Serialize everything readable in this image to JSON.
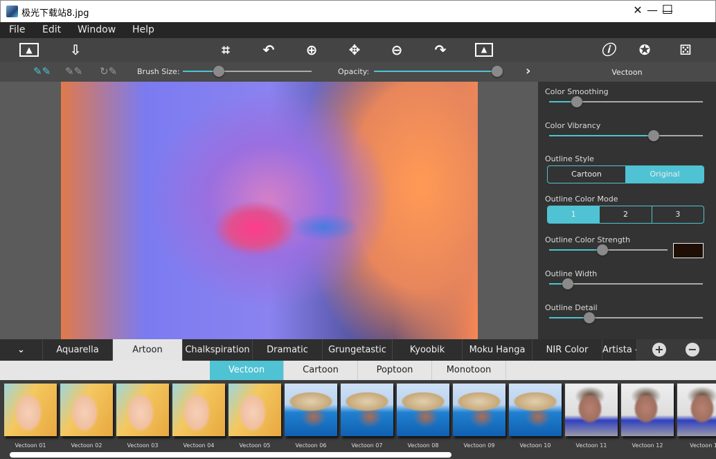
{
  "window": {
    "title": "极光下载站8.jpg",
    "minimize": "—",
    "maximize": "☐",
    "close": "✕"
  },
  "menu": [
    "File",
    "Edit",
    "Window",
    "Help"
  ],
  "toolbar": {
    "icons": [
      "open-image-icon",
      "save-icon",
      "crop-icon",
      "undo-icon",
      "zoom-in-icon",
      "pan-icon",
      "zoom-out-icon",
      "redo-icon",
      "fit-image-icon",
      "info-icon",
      "settings-icon",
      "random-dice-icon"
    ]
  },
  "brushbar": {
    "brush_size_label": "Brush Size:",
    "brush_size_value": 28,
    "opacity_label": "Opacity:",
    "opacity_value": 100,
    "expand": "›"
  },
  "panel": {
    "title": "Vectoon",
    "color_smoothing": {
      "label": "Color Smoothing",
      "value": 18
    },
    "color_vibrancy": {
      "label": "Color Vibrancy",
      "value": 68
    },
    "outline_style": {
      "label": "Outline Style",
      "options": [
        "Cartoon",
        "Original"
      ],
      "selected": "Original"
    },
    "outline_color_mode": {
      "label": "Outline Color Mode",
      "options": [
        "1",
        "2",
        "3"
      ],
      "selected": "1"
    },
    "outline_color_strength": {
      "label": "Outline Color Strength",
      "value": 45,
      "color": "#1e0e04"
    },
    "outline_width": {
      "label": "Outline Width",
      "value": 12
    },
    "outline_detail": {
      "label": "Outline Detail",
      "value": 26
    }
  },
  "categories": {
    "collapse": "⌄",
    "tabs": [
      "Aquarella",
      "Artoon",
      "Chalkspiration",
      "Dramatic",
      "Grungetastic",
      "Kyoobik",
      "Moku Hanga",
      "NIR Color",
      "Artista -"
    ],
    "selected": "Artoon",
    "add": "+",
    "remove": "−"
  },
  "subtabs": {
    "tabs": [
      "Vectoon",
      "Cartoon",
      "Poptoon",
      "Monotoon"
    ],
    "selected": "Vectoon"
  },
  "presets": [
    "Vectoon 01",
    "Vectoon 02",
    "Vectoon 03",
    "Vectoon 04",
    "Vectoon 05",
    "Vectoon 06",
    "Vectoon 07",
    "Vectoon 08",
    "Vectoon 09",
    "Vectoon 10",
    "Vectoon 11",
    "Vectoon 12",
    "Vectoon 1"
  ],
  "colors": {
    "accent": "#4fc3d3",
    "menubar": "#262626",
    "panel": "#333333"
  }
}
